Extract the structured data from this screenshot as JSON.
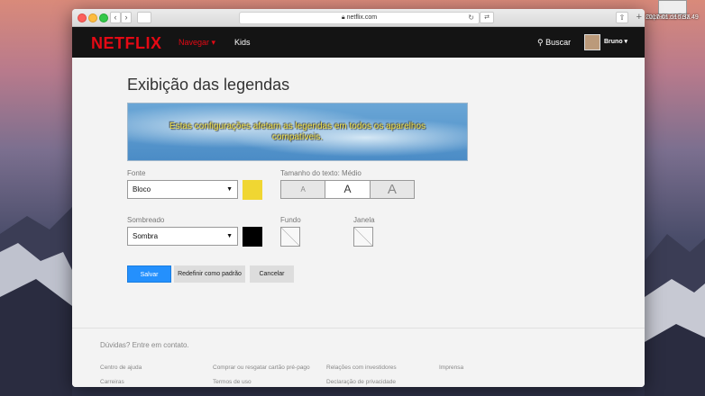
{
  "desktop": {
    "file_label_line1": "Captura de Tela",
    "file_label_line2": "2017-01...16.37.49"
  },
  "browser": {
    "url": "netflix.com",
    "lock_icon": "lock-icon",
    "reload_icon": "reload-icon"
  },
  "header": {
    "logo": "NETFLIX",
    "nav_browse": "Navegar ▾",
    "nav_kids": "Kids",
    "search_label": "Buscar",
    "user_name": "Bruno ▾"
  },
  "page": {
    "title": "Exibição das legendas",
    "banner_text": "Estas configurações afetam as legendas em todos os aparelhos compatíveis.",
    "font_label": "Fonte",
    "font_value": "Bloco",
    "font_color": "#f0d632",
    "text_size_label": "Tamanho do texto: Médio",
    "size_small": "A",
    "size_medium": "A",
    "size_large": "A",
    "shadow_label": "Sombreado",
    "shadow_value": "Sombra",
    "shadow_color": "#000000",
    "background_label": "Fundo",
    "window_label": "Janela",
    "save_label": "Salvar",
    "reset_label": "Redefinir como padrão",
    "cancel_label": "Cancelar"
  },
  "footer": {
    "contact": "Dúvidas? Entre em contato.",
    "links": [
      "Centro de ajuda",
      "Comprar ou resgatar cartão pré-pago",
      "Relações com investidores",
      "Imprensa",
      "Carreiras",
      "Termos de uso",
      "Declaração de privacidade"
    ]
  }
}
